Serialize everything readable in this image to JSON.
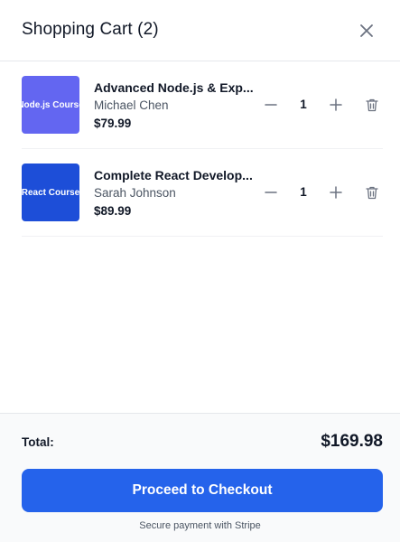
{
  "header": {
    "title": "Shopping Cart (2)",
    "close_icon": "close-icon"
  },
  "cart": {
    "items": [
      {
        "thumbnail_label": "Node.js Course",
        "thumbnail_color": "#6366f1",
        "title": "Advanced Node.js & Exp...",
        "author": "Michael Chen",
        "price": "$79.99",
        "quantity": "1"
      },
      {
        "thumbnail_label": "React Course",
        "thumbnail_color": "#1d4ed8",
        "title": "Complete React Develop...",
        "author": "Sarah Johnson",
        "price": "$89.99",
        "quantity": "1"
      }
    ]
  },
  "footer": {
    "total_label": "Total:",
    "total_value": "$169.98",
    "checkout_label": "Proceed to Checkout",
    "secure_note": "Secure payment with Stripe"
  },
  "colors": {
    "accent": "#2563eb",
    "icon_gray": "#6b7280",
    "footer_bg": "#f9fafb"
  }
}
